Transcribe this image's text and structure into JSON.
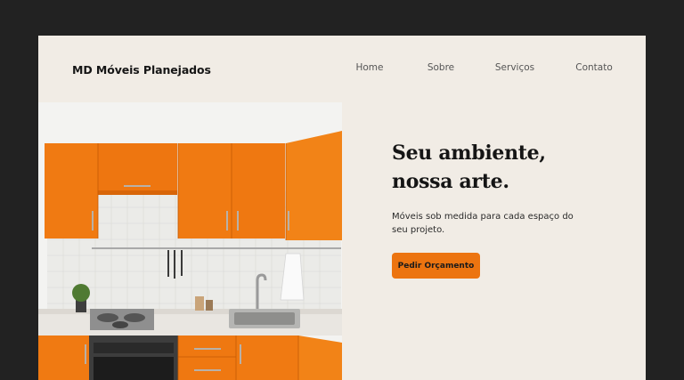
{
  "header": {
    "brand": "MD Móveis Planejados",
    "nav": [
      {
        "label": "Home"
      },
      {
        "label": "Sobre"
      },
      {
        "label": "Serviços"
      },
      {
        "label": "Contato"
      }
    ]
  },
  "hero": {
    "headline_line1": "Seu ambiente,",
    "headline_line2": "nossa arte.",
    "subtitle": "Móveis sob medida para cada espaço do seu projeto.",
    "cta_label": "Pedir Orçamento",
    "image_alt": "Cozinha planejada com armários laranja",
    "accent_color": "#ec7410",
    "background_color": "#f1ece5"
  }
}
